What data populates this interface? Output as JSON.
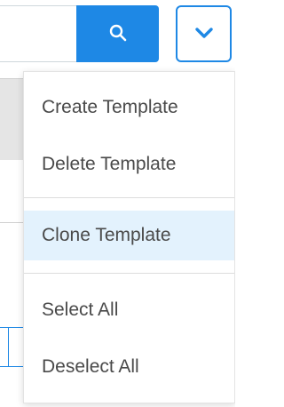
{
  "search": {
    "placeholder": ""
  },
  "icons": {
    "search": "search-icon",
    "toggle": "chevron-down-icon"
  },
  "colors": {
    "accent": "#1e88e5",
    "active_bg": "#e3f2fd",
    "text": "#4a4a4a"
  },
  "menu": {
    "items": [
      {
        "label": "Create Template",
        "active": false
      },
      {
        "label": "Delete Template",
        "active": false
      },
      {
        "label": "Clone Template",
        "active": true
      },
      {
        "label": "Select All",
        "active": false
      },
      {
        "label": "Deselect All",
        "active": false
      }
    ]
  }
}
